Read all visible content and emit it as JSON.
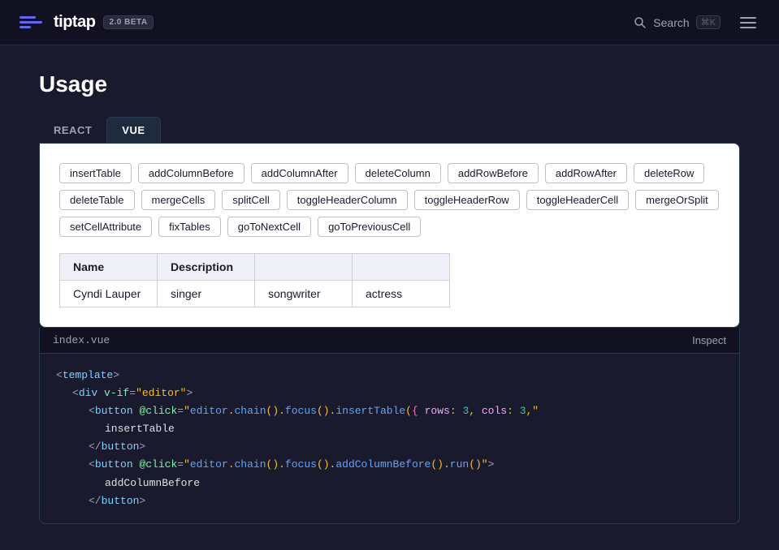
{
  "header": {
    "brand": "tiptap",
    "version": "2.0 BETA",
    "search_label": "Search",
    "search_kbd": "⌘K"
  },
  "page": {
    "title": "Usage"
  },
  "tabs": [
    {
      "id": "react",
      "label": "REACT",
      "active": false
    },
    {
      "id": "vue",
      "label": "VUE",
      "active": true
    }
  ],
  "tags": [
    "insertTable",
    "addColumnBefore",
    "addColumnAfter",
    "deleteColumn",
    "addRowBefore",
    "addRowAfter",
    "deleteRow",
    "deleteTable",
    "mergeCells",
    "splitCell",
    "toggleHeaderColumn",
    "toggleHeaderRow",
    "toggleHeaderCell",
    "mergeOrSplit",
    "setCellAttribute",
    "fixTables",
    "goToNextCell",
    "goToPreviousCell"
  ],
  "table": {
    "headers": [
      "Name",
      "Description"
    ],
    "rows": [
      {
        "cells": [
          "Cyndi Lauper",
          "singer",
          "songwriter",
          "actress"
        ]
      }
    ]
  },
  "code": {
    "filename": "index.vue",
    "inspect_label": "Inspect",
    "lines": [
      {
        "indent": 0,
        "content": "<template>"
      },
      {
        "indent": 1,
        "content": "<div v-if=\"editor\">"
      },
      {
        "indent": 2,
        "content": "<button @click=\"editor.chain().focus().insertTable({ rows: 3, cols: 3,"
      },
      {
        "indent": 3,
        "content": "insertTable"
      },
      {
        "indent": 2,
        "content": "</button>"
      },
      {
        "indent": 2,
        "content": "<button @click=\"editor.chain().focus().addColumnBefore().run()\">"
      },
      {
        "indent": 3,
        "content": "addColumnBefore"
      },
      {
        "indent": 2,
        "content": "</button>"
      }
    ]
  }
}
